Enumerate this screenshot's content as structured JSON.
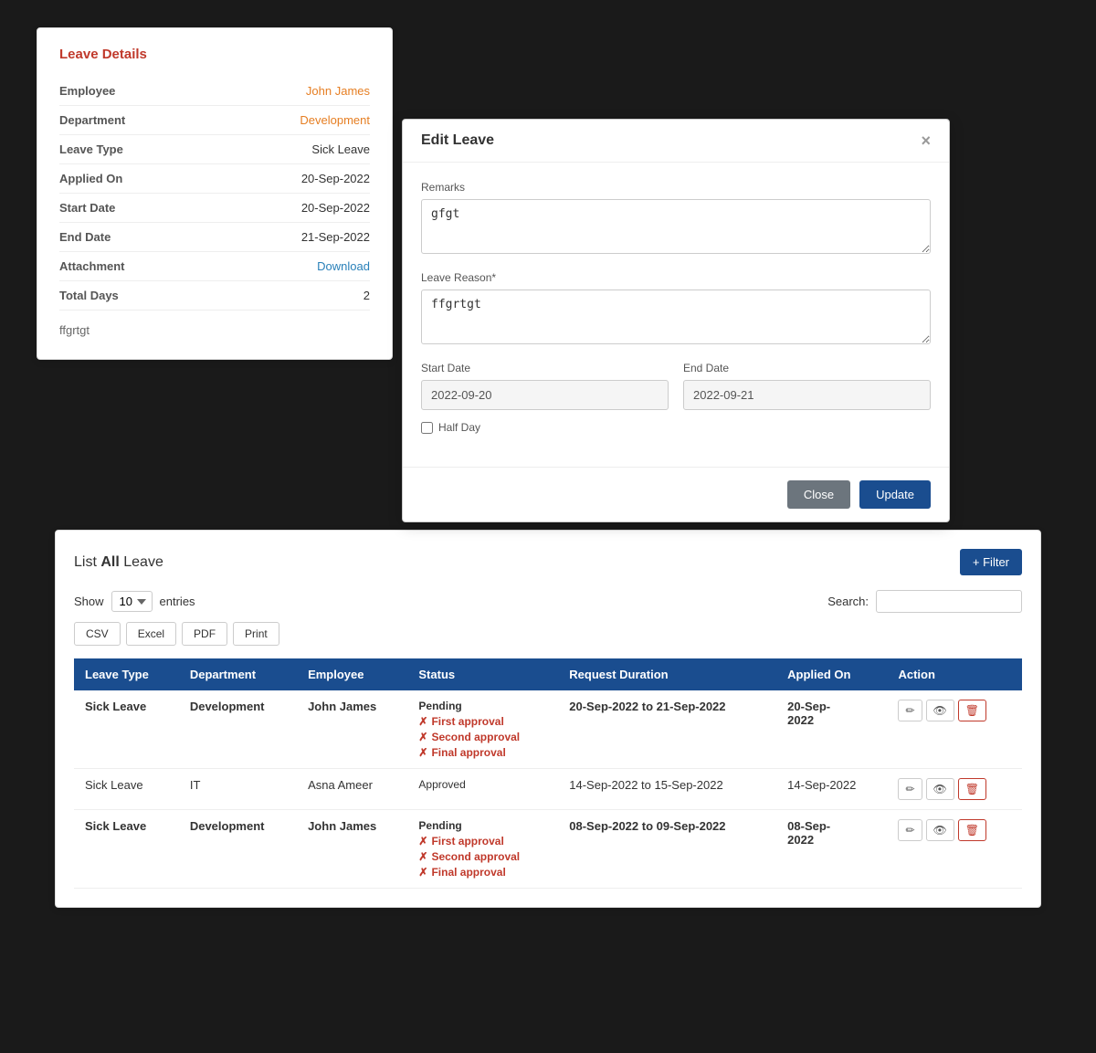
{
  "leaveDetails": {
    "title": "Leave Details",
    "fields": [
      {
        "label": "Employee",
        "value": "John James",
        "type": "orange"
      },
      {
        "label": "Department",
        "value": "Development",
        "type": "orange"
      },
      {
        "label": "Leave Type",
        "value": "Sick Leave",
        "type": "normal"
      },
      {
        "label": "Applied On",
        "value": "20-Sep-2022",
        "type": "normal"
      },
      {
        "label": "Start Date",
        "value": "20-Sep-2022",
        "type": "normal"
      },
      {
        "label": "End Date",
        "value": "21-Sep-2022",
        "type": "normal"
      },
      {
        "label": "Attachment",
        "value": "Download",
        "type": "link"
      },
      {
        "label": "Total Days",
        "value": "2",
        "type": "normal"
      }
    ],
    "note": "ffgrtgt"
  },
  "editLeave": {
    "title": "Edit Leave",
    "remarksLabel": "Remarks",
    "remarksValue": "gfgt",
    "leaveReasonLabel": "Leave Reason*",
    "leaveReasonValue": "ffgrtgt",
    "startDateLabel": "Start Date",
    "startDateValue": "2022-09-20",
    "endDateLabel": "End Date",
    "endDateValue": "2022-09-21",
    "halfDayLabel": "Half Day",
    "closeBtn": "Close",
    "updateBtn": "Update"
  },
  "listLeave": {
    "title": "List",
    "titleBold": "All",
    "titleSuffix": "Leave",
    "filterBtn": "+ Filter",
    "showLabel": "Show",
    "entriesLabel": "entries",
    "entriesValue": "10",
    "searchLabel": "Search:",
    "exportButtons": [
      "CSV",
      "Excel",
      "PDF",
      "Print"
    ],
    "columns": [
      "Leave Type",
      "Department",
      "Employee",
      "Status",
      "Request Duration",
      "Applied On",
      "Action"
    ],
    "rows": [
      {
        "leaveType": "Sick Leave",
        "department": "Development",
        "employee": "John James",
        "status": "Pending",
        "approvals": [
          "First approval",
          "Second approval",
          "Final approval"
        ],
        "duration": "20-Sep-2022 to 21-Sep-2022",
        "appliedOn": "20-Sep-2022",
        "bold": true
      },
      {
        "leaveType": "Sick Leave",
        "department": "IT",
        "employee": "Asna Ameer",
        "status": "Approved",
        "approvals": [],
        "duration": "14-Sep-2022 to 15-Sep-2022",
        "appliedOn": "14-Sep-2022",
        "bold": false
      },
      {
        "leaveType": "Sick Leave",
        "department": "Development",
        "employee": "John James",
        "status": "Pending",
        "approvals": [
          "First approval",
          "Second approval",
          "Final approval"
        ],
        "duration": "08-Sep-2022 to 09-Sep-2022",
        "appliedOn": "08-Sep-2022",
        "bold": true
      }
    ]
  }
}
